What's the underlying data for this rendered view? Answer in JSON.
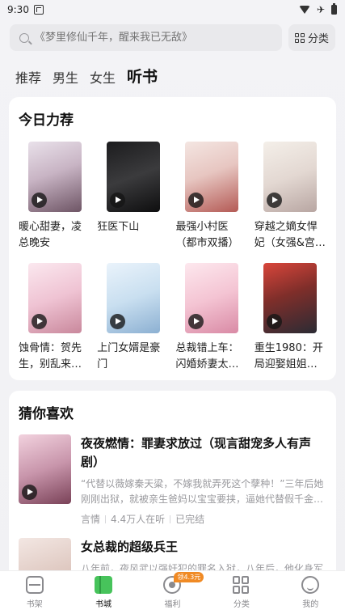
{
  "status_bar": {
    "time": "9:30"
  },
  "search": {
    "placeholder": "《梦里修仙千年，醒来我已无敌》",
    "category_label": "分类"
  },
  "tabs": [
    {
      "label": "推荐",
      "active": false
    },
    {
      "label": "男生",
      "active": false
    },
    {
      "label": "女生",
      "active": false
    },
    {
      "label": "听书",
      "active": true
    }
  ],
  "recommend": {
    "title": "今日力荐",
    "books": [
      {
        "title": "暖心甜妻，凌总晚安",
        "cover_text": ""
      },
      {
        "title": "狂医下山",
        "cover_text": ""
      },
      {
        "title": "最强小村医（都市双播）",
        "cover_text": ""
      },
      {
        "title": "穿越之嫡女悍妃（女强&宫…",
        "cover_text": ""
      },
      {
        "title": "蚀骨情：贺先生，别乱来…",
        "cover_text": ""
      },
      {
        "title": "上门女婿是豪门",
        "cover_text": ""
      },
      {
        "title": "总裁错上车：闪婚娇妻太…",
        "cover_text": ""
      },
      {
        "title": "重生1980：开局迎娶姐姐…",
        "cover_text": ""
      }
    ]
  },
  "guess": {
    "title": "猜你喜欢",
    "items": [
      {
        "title": "夜夜燃情：罪妻求放过（现言甜宠多人有声剧）",
        "desc": "“代替以薇嫁秦天粱，不嫁我就弄死这个孽种！”三年后她刚刚出狱，就被亲生爸妈以宝宝要挟，逼她代替假千金…",
        "genre": "言情",
        "listeners": "4.4万人在听",
        "status": "已完结"
      },
      {
        "title": "女总裁的超级兵王",
        "desc": "八年前，夜风武以强奸犯的罪名入狱，八年后，他化身军中战神回归都市，当他得知那个因自己而被祸害的女…",
        "genre": "",
        "listeners": "",
        "status": ""
      }
    ]
  },
  "bottom_nav": [
    {
      "label": "书架",
      "icon": "bookshelf-icon",
      "active": false
    },
    {
      "label": "书城",
      "icon": "bookstore-icon",
      "active": true
    },
    {
      "label": "福利",
      "icon": "welfare-icon",
      "active": false,
      "badge": "领4.3元"
    },
    {
      "label": "分类",
      "icon": "category-icon",
      "active": false
    },
    {
      "label": "我的",
      "icon": "profile-icon",
      "active": false
    }
  ],
  "colors": {
    "accent_green": "#47c35b",
    "badge_orange": "#f08a24",
    "text_muted": "#9a9a9e"
  }
}
